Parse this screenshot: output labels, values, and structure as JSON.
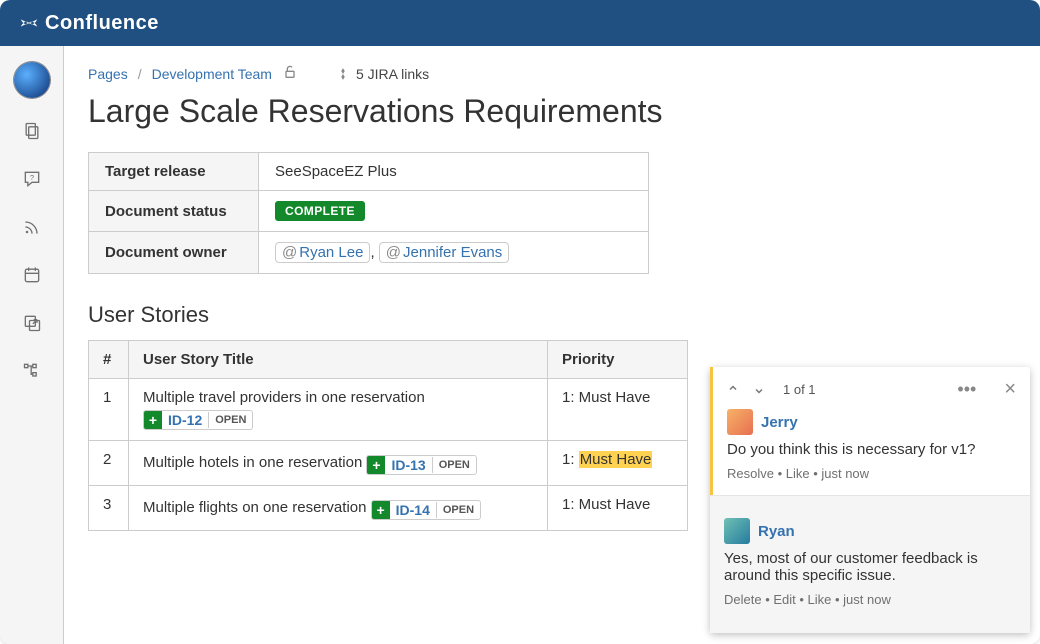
{
  "brand": "Confluence",
  "breadcrumb": {
    "root": "Pages",
    "space": "Development Team"
  },
  "jira_links_label": "5 JIRA links",
  "page_title": "Large Scale Reservations Requirements",
  "meta": {
    "rows": [
      {
        "label": "Target release",
        "type": "text",
        "value": "SeeSpaceEZ Plus"
      },
      {
        "label": "Document status",
        "type": "status",
        "value": "COMPLETE"
      },
      {
        "label": "Document owner",
        "type": "mentions",
        "users": [
          "Ryan Lee",
          "Jennifer Evans"
        ]
      }
    ]
  },
  "section_title": "User Stories",
  "stories": {
    "headers": [
      "#",
      "User Story Title",
      "Priority"
    ],
    "rows": [
      {
        "n": "1",
        "title": "Multiple travel providers in one reservation",
        "jira": {
          "key": "ID-12",
          "status": "OPEN"
        },
        "priority_prefix": "1: ",
        "priority_rest": "Must Have",
        "hl": false,
        "inline": false
      },
      {
        "n": "2",
        "title": "Multiple hotels in one reservation",
        "jira": {
          "key": "ID-13",
          "status": "OPEN"
        },
        "priority_prefix": "1: ",
        "priority_rest": "Must Have",
        "hl": true,
        "inline": true
      },
      {
        "n": "3",
        "title": "Multiple flights on one reservation",
        "jira": {
          "key": "ID-14",
          "status": "OPEN"
        },
        "priority_prefix": "1: ",
        "priority_rest": "Must Have",
        "hl": false,
        "inline": true
      }
    ]
  },
  "comments": {
    "nav_count": "1 of 1",
    "thread": [
      {
        "user": "Jerry",
        "body": "Do you think this is necessary for v1?",
        "actions": "Resolve • Like • just now",
        "reply": false
      },
      {
        "user": "Ryan",
        "body": "Yes, most of our customer feedback is around this specific issue.",
        "actions": "Delete • Edit • Like • just now",
        "reply": true
      }
    ]
  }
}
